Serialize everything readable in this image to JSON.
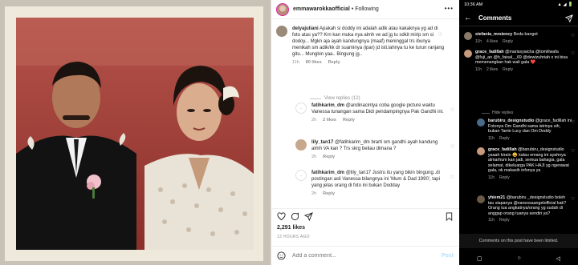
{
  "instagram": {
    "username": "emmawarokkaofficial",
    "follow_label": "• Following",
    "comments": [
      {
        "user": "delyajuliani",
        "text": "Apakah si doddy ini adalah adik atau kakaknya yg ad di foto atas ya?? Krn kan muka nya almh ve ad jg tu sdkit mirip sm si dodoy... Mgkn aja ayah kandungnya (maaf) meninggal trs ibunya menikah sm adik/kk dr suaminya (ipar) jd isti.lahnya tu ke turun ranjang gitu... Mungkin yaa.. Bingung jg..",
        "time": "11h",
        "likes": "80 likes",
        "reply": "Reply"
      },
      {
        "user": "fatihkarim_dm",
        "text": "@andinacintya coba google picture waktu Vanessa tunangan sama Didi pendampingnya Pak Gandhi ini.",
        "time": "2h",
        "likes": "2 likes",
        "reply": "Reply"
      },
      {
        "user": "lily_tan17",
        "text": "@fatihkarim_dm brarti om gandhi ayah kandung almh VA kan ? Trs skrg beliau dimana ?",
        "time": "2h",
        "likes": "",
        "reply": "Reply"
      },
      {
        "user": "fatihkarim_dm",
        "text": "@lily_tan17 Justru itu yang bikin bingung..di postingan asli Vanessa bilangnya ini 'Mum & Dad 1990', tapi yang jelas orang di foto ini bukan Dodday",
        "time": "2h",
        "likes": "",
        "reply": "Reply"
      }
    ],
    "view_replies": "View replies (12)",
    "likes_count": "2,291 likes",
    "timestamp": "12 HOURS AGO",
    "add_comment_placeholder": "Add a comment...",
    "post_label": "Post"
  },
  "mobile": {
    "status_time": "10:36 AM",
    "status_icons": "▲ ◢ 🔋",
    "title": "Comments",
    "comments": [
      {
        "user": "stefania_mrsiency",
        "text": "Beda banget",
        "time": "11h",
        "likes": "4 likes",
        "reply": "Reply"
      },
      {
        "user": "grace_fadillah",
        "text": "@marissyaicha @tomiliwafa @fuji_an @h_faisal__69 @dewizuhriah x ini bisa memenangkan hak wali gala ❤️",
        "time": "11h",
        "likes": "2 likes",
        "reply": "Reply"
      },
      {
        "user": "barubiru_designstudio",
        "text": "@grace_fadillah ini Fotonya Om Gandhi sama istrinya sih, bukan Tante Lucy dan Om Doddy",
        "time": "11h",
        "likes": "",
        "reply": "Reply"
      },
      {
        "user": "grace_fadillah",
        "text": "@barubiru_designstudio yaaah kirain 😀 kalau emang ini ayahnya almarhum kan jadi, semua bahagia, gala selamat, dikeluarga PAK HAJI yg ngerawat gala, ok makasih infonya ya",
        "time": "11h",
        "likes": "",
        "reply": "Reply"
      },
      {
        "user": "yhiem21",
        "text": "@barubiru _designstudio boleh tau siapanya @vanessaangelofficial kak? Orang tua angkatnya/orang yg sudah di anggap orang tuanya sendiri ya?",
        "time": "11h",
        "likes": "",
        "reply": "Reply"
      }
    ],
    "hide_replies": "Hide replies",
    "limited_notice": "Comments on this post have been limited."
  }
}
